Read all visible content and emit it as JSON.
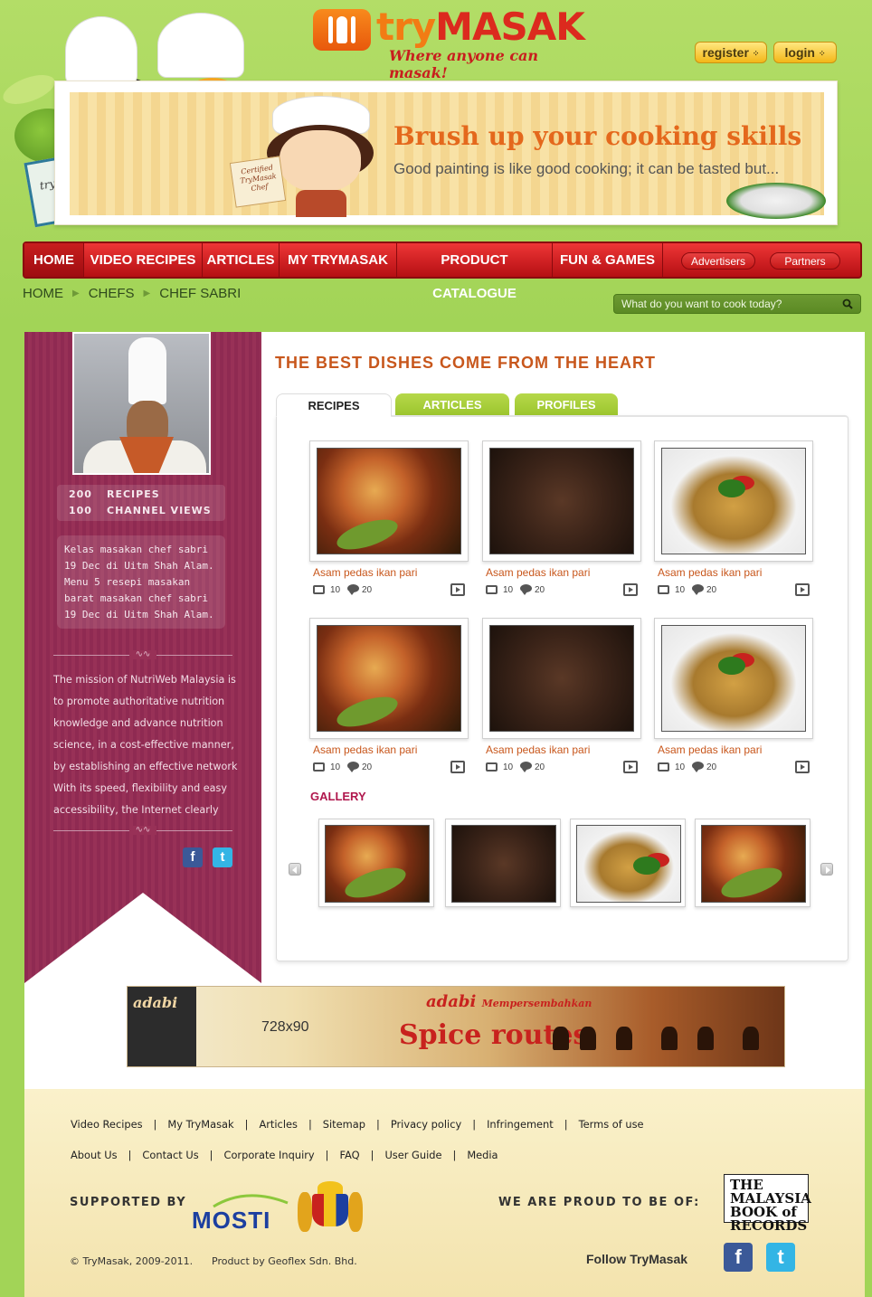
{
  "brand": {
    "name_part1": "try",
    "name_part2": "MASAK",
    "tagline": "Where anyone can masak!"
  },
  "auth": {
    "register_label": "register",
    "login_label": "login"
  },
  "banner": {
    "title": "Brush up your cooking skills",
    "subtitle": "Good painting is like good cooking; it can be tasted but...",
    "badge": "Certified TryMasak Chef",
    "book_label": "try masak"
  },
  "nav": {
    "items": [
      {
        "label": "HOME"
      },
      {
        "label": "VIDEO RECIPES"
      },
      {
        "label": "ARTICLES"
      },
      {
        "label": "MY TRYMASAK"
      },
      {
        "label": "PRODUCT CATALOGUE"
      },
      {
        "label": "FUN & GAMES"
      }
    ],
    "pills": [
      {
        "label": "Advertisers"
      },
      {
        "label": "Partners"
      }
    ]
  },
  "breadcrumb": [
    "HOME",
    "CHEFS",
    "CHEF SABRI"
  ],
  "search": {
    "placeholder": "What do you want to cook today?"
  },
  "profile": {
    "stats": [
      {
        "value": "200",
        "label": "RECIPES"
      },
      {
        "value": "100",
        "label": "CHANNEL VIEWS"
      }
    ],
    "bio": "Kelas masakan chef sabri 19 Dec di Uitm Shah Alam. Menu 5 resepi masakan barat masakan chef sabri 19 Dec di Uitm Shah Alam.",
    "mission": "The mission of NutriWeb Malaysia is to promote authoritative nutrition knowledge and advance nutrition science, in a cost-effective manner, by establishing an effective network With its speed, flexibility and easy accessibility, the Internet clearly",
    "social": [
      {
        "icon": "facebook-icon",
        "glyph": "f",
        "color": "#3b5998"
      },
      {
        "icon": "twitter-icon",
        "glyph": "t",
        "color": "#33b5e5"
      }
    ]
  },
  "content": {
    "title": "THE BEST DISHES COME FROM THE HEART",
    "tabs": [
      {
        "label": "RECIPES"
      },
      {
        "label": "ARTICLES"
      },
      {
        "label": "PROFILES"
      }
    ],
    "recipes": [
      {
        "title": "Asam pedas ikan pari",
        "views": "10",
        "comments": "20",
        "image": "fish"
      },
      {
        "title": "Asam pedas ikan pari",
        "views": "10",
        "comments": "20",
        "image": "cake"
      },
      {
        "title": "Asam pedas ikan pari",
        "views": "10",
        "comments": "20",
        "image": "soup"
      },
      {
        "title": "Asam pedas ikan pari",
        "views": "10",
        "comments": "20",
        "image": "fish"
      },
      {
        "title": "Asam pedas ikan pari",
        "views": "10",
        "comments": "20",
        "image": "cake"
      },
      {
        "title": "Asam pedas ikan pari",
        "views": "10",
        "comments": "20",
        "image": "soup"
      }
    ],
    "gallery_title": "GALLERY",
    "gallery": [
      "fish",
      "cake",
      "soup",
      "fish"
    ]
  },
  "ad": {
    "size_label": "728x90",
    "brand": "adabi",
    "tagline": "Mempersembahkan",
    "campaign": "Spice routes"
  },
  "footer": {
    "links_row1": [
      "Video Recipes",
      "My TryMasak",
      "Articles",
      "Sitemap",
      "Privacy policy",
      "Infringement",
      "Terms of use"
    ],
    "links_row2": [
      "About Us",
      "Contact Us",
      "Corporate Inquiry",
      "FAQ",
      "User Guide",
      "Media"
    ],
    "supported_by": "SUPPORTED BY",
    "mosti_label": "MOSTI",
    "proud_label": "WE ARE PROUD TO BE OF:",
    "mbr_label": "THE MALAYSIA BOOK of RECORDS",
    "copyright": "© TryMasak, 2009-2011.",
    "product_by": "Product by Geoflex Sdn. Bhd.",
    "follow_label": "Follow TryMasak",
    "social": [
      {
        "icon": "facebook-icon",
        "glyph": "f",
        "color": "#3b5998"
      },
      {
        "icon": "twitter-icon",
        "glyph": "t",
        "color": "#33b5e5"
      }
    ]
  },
  "colors": {
    "nav_red": "#d42424",
    "accent_orange": "#c8571c",
    "sidebar_plum": "#983157",
    "page_green": "#a6d65a"
  }
}
